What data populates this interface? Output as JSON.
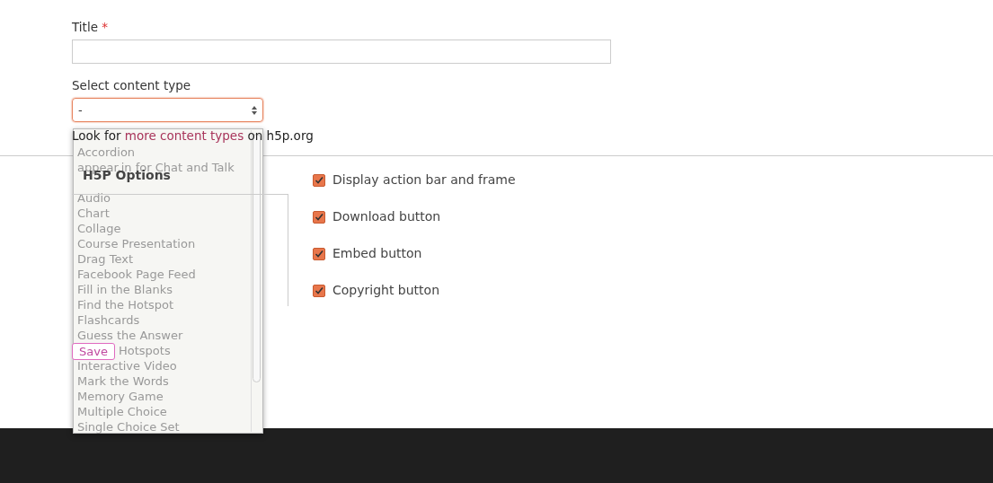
{
  "title_field": {
    "label": "Title",
    "required_mark": "*"
  },
  "content_type": {
    "label": "Select content type",
    "value": "-",
    "expanded": true,
    "options": [
      {
        "kind": "option",
        "label": "Accordion"
      },
      {
        "kind": "option",
        "label": "appear.in for Chat and Talk"
      },
      {
        "kind": "covered"
      },
      {
        "kind": "option",
        "label": "Audio"
      },
      {
        "kind": "option",
        "label": "Chart"
      },
      {
        "kind": "option",
        "label": "Collage"
      },
      {
        "kind": "option",
        "label": "Course Presentation"
      },
      {
        "kind": "option",
        "label": "Drag Text"
      },
      {
        "kind": "option",
        "label": "Facebook Page Feed"
      },
      {
        "kind": "option",
        "label": "Fill in the Blanks"
      },
      {
        "kind": "option",
        "label": "Find the Hotspot"
      },
      {
        "kind": "option",
        "label": "Flashcards"
      },
      {
        "kind": "option",
        "label": "Guess the Answer"
      },
      {
        "kind": "partly-covered",
        "label": "Hotspots"
      },
      {
        "kind": "option",
        "label": "Interactive Video"
      },
      {
        "kind": "option",
        "label": "Mark the Words"
      },
      {
        "kind": "option",
        "label": "Memory Game"
      },
      {
        "kind": "option",
        "label": "Multiple Choice"
      },
      {
        "kind": "option",
        "label": "Single Choice Set"
      }
    ],
    "hint": {
      "before": "Look for ",
      "link": "more content types",
      "after": " on h5p.org"
    }
  },
  "h5p_options": {
    "title": "H5P Options",
    "checkboxes": [
      {
        "label": "Display action bar and frame",
        "checked": true
      },
      {
        "label": "Download button",
        "checked": true
      },
      {
        "label": "Embed button",
        "checked": true
      },
      {
        "label": "Copyright button",
        "checked": true
      }
    ]
  },
  "save_button": "Save"
}
